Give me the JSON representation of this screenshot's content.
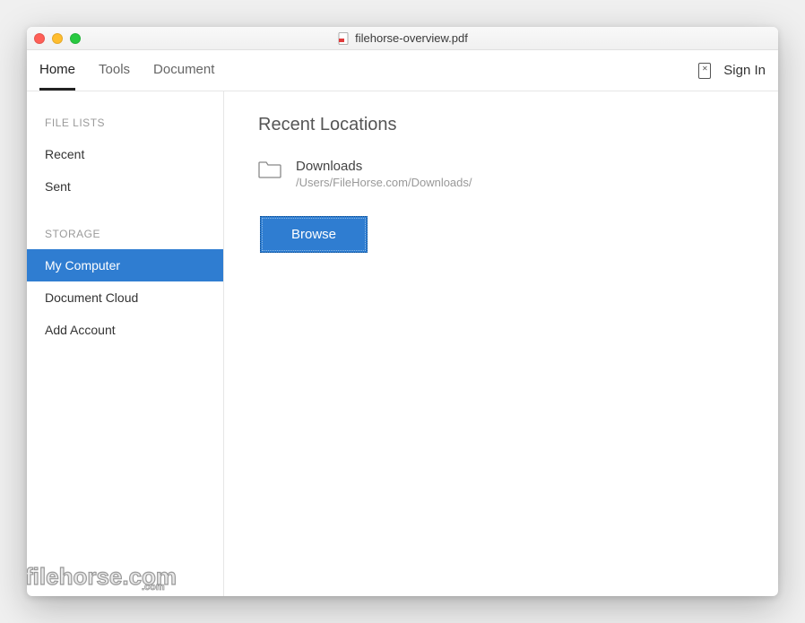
{
  "window": {
    "title": "filehorse-overview.pdf"
  },
  "toolbar": {
    "tabs": [
      {
        "label": "Home",
        "active": true
      },
      {
        "label": "Tools",
        "active": false
      },
      {
        "label": "Document",
        "active": false
      }
    ],
    "sign_in": "Sign In"
  },
  "sidebar": {
    "sections": [
      {
        "header": "FILE LISTS",
        "items": [
          {
            "label": "Recent",
            "selected": false
          },
          {
            "label": "Sent",
            "selected": false
          }
        ]
      },
      {
        "header": "STORAGE",
        "items": [
          {
            "label": "My Computer",
            "selected": true
          },
          {
            "label": "Document Cloud",
            "selected": false
          },
          {
            "label": "Add Account",
            "selected": false
          }
        ]
      }
    ]
  },
  "main": {
    "heading": "Recent Locations",
    "locations": [
      {
        "name": "Downloads",
        "path": "/Users/FileHorse.com/Downloads/"
      }
    ],
    "browse_label": "Browse"
  },
  "watermark": "filehorse.com"
}
